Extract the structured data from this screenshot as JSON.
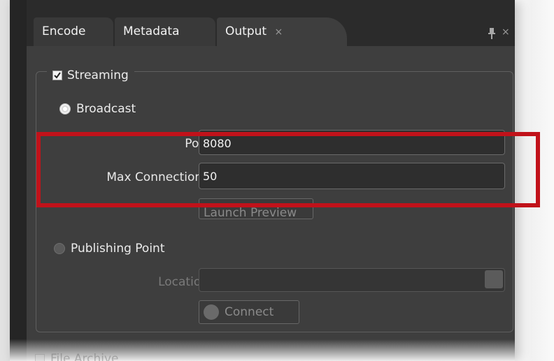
{
  "tabs": [
    {
      "label": "Encode"
    },
    {
      "label": "Metadata"
    },
    {
      "label": "Output",
      "close": "×",
      "active": true
    }
  ],
  "panel": {
    "close": "×"
  },
  "streaming": {
    "label": "Streaming",
    "checked": true,
    "broadcast": {
      "label": "Broadcast",
      "selected": true,
      "port_label": "Port",
      "port_value": "8080",
      "max_connections_label": "Max Connections",
      "max_connections_value": "50",
      "launch_preview_label": "Launch Preview"
    },
    "publishing_point": {
      "label": "Publishing Point",
      "selected": false,
      "location_label": "Location",
      "location_value": "",
      "connect_label": "Connect"
    }
  },
  "file_archive": {
    "label": "File Archive",
    "checked": false
  },
  "colors": {
    "highlight": "#c1121a",
    "panel": "#3e3e3e",
    "text": "#ececec"
  },
  "icons": [
    "pin-icon",
    "checkmark-icon",
    "close-icon"
  ]
}
